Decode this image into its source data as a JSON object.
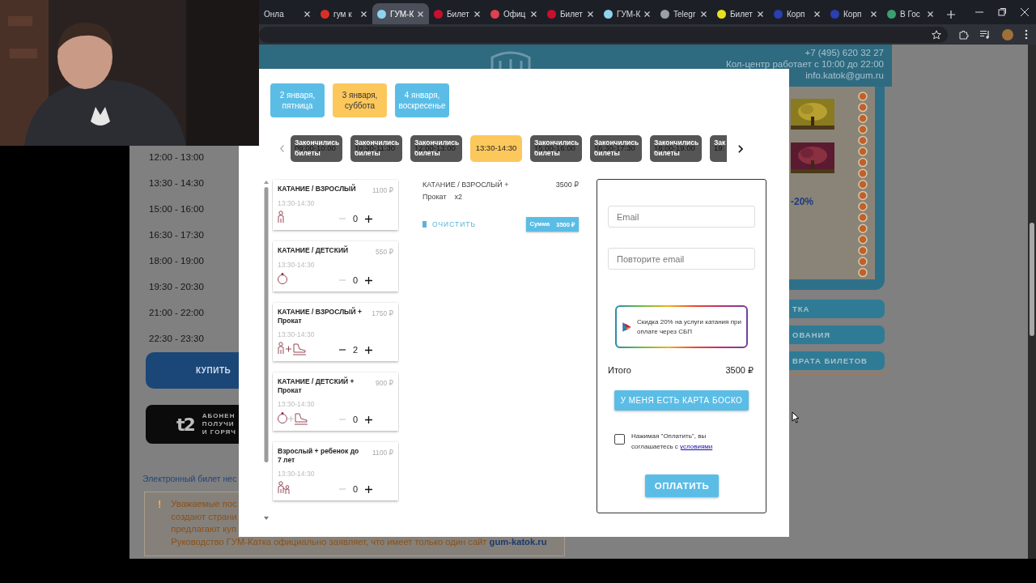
{
  "browser": {
    "tabs": [
      {
        "title": "Онла",
        "selected": false
      },
      {
        "title": "гум к",
        "selected": false,
        "color": "#d93025"
      },
      {
        "title": "ГУМ-К",
        "selected": true,
        "color": "#8fd3f0"
      },
      {
        "title": "Билет",
        "selected": false,
        "color": "#c8102e"
      },
      {
        "title": "Офиц",
        "selected": false,
        "color": "#e04050"
      },
      {
        "title": "Билет",
        "selected": false,
        "color": "#c8102e"
      },
      {
        "title": "ГУМ-К",
        "selected": false,
        "color": "#8fd3f0"
      },
      {
        "title": "Telegr",
        "selected": false,
        "color": "#9aa0a6"
      },
      {
        "title": "Билет",
        "selected": false,
        "color": "#e8e020"
      },
      {
        "title": "Корп",
        "selected": false,
        "color": "#2a3fb0"
      },
      {
        "title": "Корп",
        "selected": false,
        "color": "#2a3fb0"
      },
      {
        "title": "В Гос",
        "selected": false,
        "color": "#3aa070"
      }
    ]
  },
  "page": {
    "header": {
      "phone": "+7 (495) 620 32 27",
      "hours": "Кол-центр работает с 10:00 до 22:00",
      "email": "info.katok@gum.ru"
    },
    "sessions": [
      "12:00 - 13:00",
      "13:30 - 14:30",
      "15:00 - 16:00",
      "16:30 - 17:30",
      "18:00 - 19:00",
      "19:30 - 20:30",
      "21:00 - 22:00",
      "22:30 - 23:30"
    ],
    "buy_button": "КУПИТЬ",
    "promo_banner": {
      "logo": "t2",
      "lines": [
        "АБОНЕН",
        "ПОЛУЧИ",
        "И ГОРЯЧ"
      ]
    },
    "e_ticket_link": "Электронный билет нес",
    "warning": {
      "mark": "!",
      "lines": [
        "Уважаемые пос",
        "создают страни",
        "предлагают куп"
      ],
      "last_line": "Руководство ГУМ-Катка официально заявляет, что имеет только один сайт",
      "site": "gum-katok.ru"
    },
    "side_panel": {
      "discount": "-20%",
      "buttons": [
        "ТКА",
        "ОВАНИЯ",
        "ВРАТА БИЛЕТОВ"
      ]
    }
  },
  "modal": {
    "dates": [
      {
        "label": "2 января, пятница",
        "selected": false
      },
      {
        "label": "3 января, суббота",
        "selected": true
      },
      {
        "label": "4 января, воскресенье",
        "selected": false
      }
    ],
    "slots": [
      {
        "time": "09:00-10:00",
        "status": "Закончились билеты",
        "sold_out": true,
        "selected": false
      },
      {
        "time": "10:30-11:30",
        "status": "Закончились билеты",
        "sold_out": true,
        "selected": false
      },
      {
        "time": "12:00-13:00",
        "status": "Закончились билеты",
        "sold_out": true,
        "selected": false
      },
      {
        "time": "13:30-14:30",
        "sold_out": false,
        "selected": true
      },
      {
        "time": "15:00-16:00",
        "status": "Закончились билеты",
        "sold_out": true,
        "selected": false
      },
      {
        "time": "16:30-17:30",
        "status": "Закончились билеты",
        "sold_out": true,
        "selected": false
      },
      {
        "time": "18:00-19:00",
        "status": "Закончились билеты",
        "sold_out": true,
        "selected": false
      },
      {
        "time": "19:",
        "status": "Зак",
        "sold_out": true,
        "selected": false
      }
    ],
    "tickets": [
      {
        "name": "КАТАНИЕ / ВЗРОСЛЫЙ",
        "price": "1100 ₽",
        "time": "13:30-14:30",
        "kind": "adult",
        "count": "0"
      },
      {
        "name": "КАТАНИЕ / ДЕТСКИЙ",
        "price": "550 ₽",
        "time": "13:30-14:30",
        "kind": "child",
        "count": "0"
      },
      {
        "name": "КАТАНИЕ / ВЗРОСЛЫЙ + Прокат",
        "price": "1750 ₽",
        "time": "13:30-14:30",
        "kind": "adult_rental",
        "count": "2"
      },
      {
        "name": "КАТАНИЕ / ДЕТСКИЙ + Прокат",
        "price": "900 ₽",
        "time": "13:30-14:30",
        "kind": "child_rental",
        "count": "0"
      },
      {
        "name": "Взрослый + ребенок до 7 лет",
        "price": "1100 ₽",
        "time": "13:30-14:30",
        "kind": "adult_child",
        "count": "0"
      }
    ],
    "cart": {
      "items": [
        {
          "name": "КАТАНИЕ / ВЗРОСЛЫЙ + Прокат",
          "quantity": "x2",
          "price": "3500 ₽"
        }
      ],
      "clear": "ОЧИСТИТЬ",
      "sum_label": "Сумма",
      "sum": "3500 ₽"
    },
    "checkout": {
      "email_placeholder": "Email",
      "repeat_placeholder": "Повторите email",
      "sbp_text": "Скидка 20% на услуги катания при оплате через СБП",
      "total_label": "Итого",
      "total": "3500 ₽",
      "card_button": "У МЕНЯ ЕСТЬ КАРТА БОСКО",
      "agree": {
        "checked": false,
        "text": "Нажимая \"Оплатить\", вы соглашаетесь с ",
        "link": "условиями"
      },
      "pay_button": "ОПЛАТИТЬ"
    }
  }
}
